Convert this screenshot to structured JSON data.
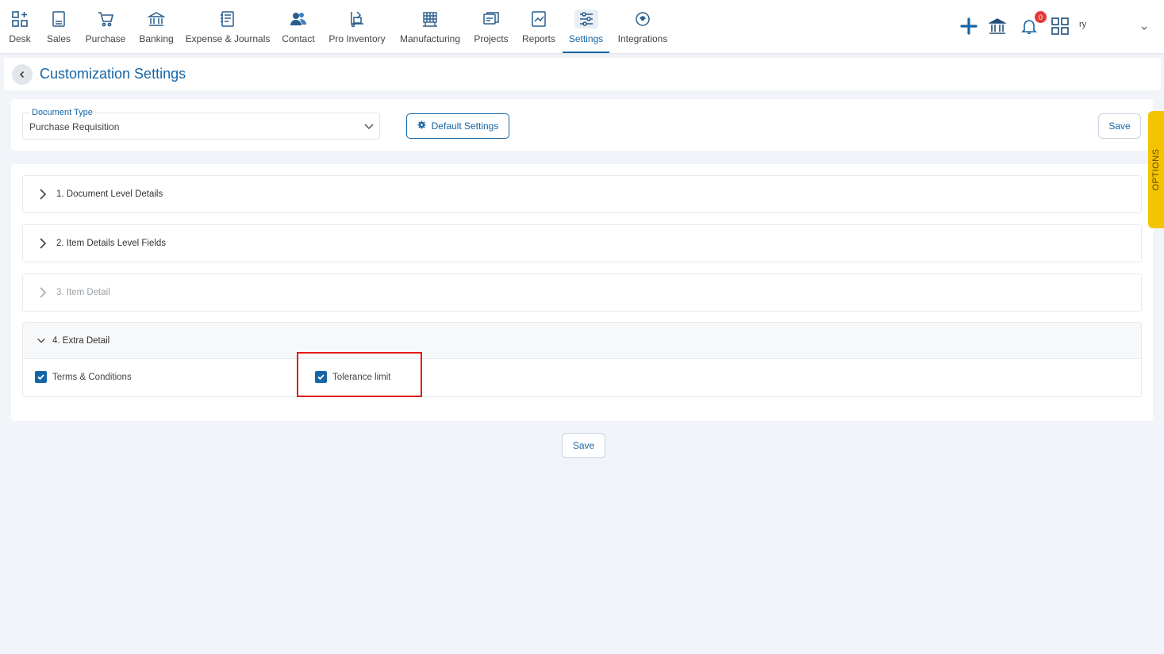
{
  "nav": {
    "items": [
      {
        "label": "Desk",
        "icon": "desk-icon"
      },
      {
        "label": "Sales",
        "icon": "sales-icon"
      },
      {
        "label": "Purchase",
        "icon": "purchase-cart-icon"
      },
      {
        "label": "Banking",
        "icon": "bank-icon"
      },
      {
        "label": "Expense & Journals",
        "icon": "journal-icon"
      },
      {
        "label": "Contact",
        "icon": "contacts-icon"
      },
      {
        "label": "Pro Inventory",
        "icon": "inventory-icon"
      },
      {
        "label": "Manufacturing",
        "icon": "manufacturing-icon"
      },
      {
        "label": "Projects",
        "icon": "projects-icon"
      },
      {
        "label": "Reports",
        "icon": "reports-icon"
      },
      {
        "label": "Settings",
        "icon": "settings-sliders-icon"
      },
      {
        "label": "Integrations",
        "icon": "integrations-icon"
      }
    ],
    "active": "Settings",
    "notification_count": "0",
    "user_name": "ry"
  },
  "header": {
    "title": "Customization Settings"
  },
  "document_type": {
    "legend": "Document Type",
    "value": "Purchase Requisition"
  },
  "buttons": {
    "default_settings": "Default Settings",
    "save": "Save",
    "save_bottom": "Save"
  },
  "sections": [
    {
      "title": "1. Document Level Details",
      "state": "collapsed"
    },
    {
      "title": "2. Item Details Level Fields",
      "state": "collapsed"
    },
    {
      "title": "3. Item Detail",
      "state": "disabled"
    },
    {
      "title": "4. Extra Detail",
      "state": "expanded"
    }
  ],
  "extra_detail": {
    "options": [
      {
        "label": "Terms & Conditions",
        "checked": true
      },
      {
        "label": "Tolerance limit",
        "checked": true
      }
    ]
  },
  "options_tab": {
    "label": "OPTIONS"
  },
  "colors": {
    "brand_blue": "#1565a6",
    "highlight_red": "#e31b1b",
    "options_yellow": "#f5c400",
    "background": "#f1f4f8"
  }
}
